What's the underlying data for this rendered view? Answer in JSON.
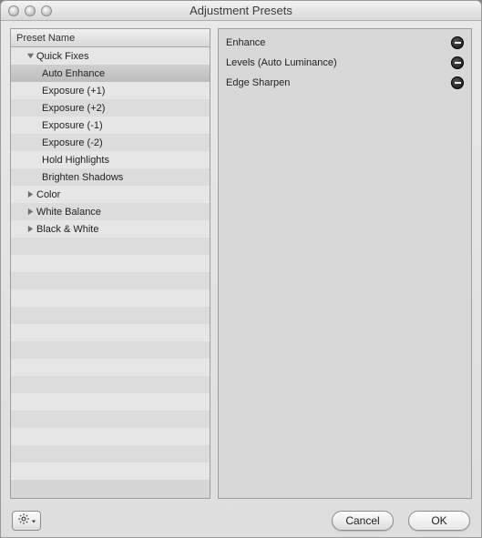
{
  "window": {
    "title": "Adjustment Presets"
  },
  "left": {
    "header": "Preset Name",
    "groups": [
      {
        "name": "Quick Fixes",
        "expanded": true,
        "children": [
          "Auto Enhance",
          "Exposure (+1)",
          "Exposure (+2)",
          "Exposure (-1)",
          "Exposure (-2)",
          "Hold Highlights",
          "Brighten Shadows"
        ],
        "selectedIndex": 0
      },
      {
        "name": "Color",
        "expanded": false,
        "children": []
      },
      {
        "name": "White Balance",
        "expanded": false,
        "children": []
      },
      {
        "name": "Black & White",
        "expanded": false,
        "children": []
      }
    ]
  },
  "right": {
    "adjustments": [
      "Enhance",
      "Levels (Auto Luminance)",
      "Edge Sharpen"
    ]
  },
  "footer": {
    "cancel": "Cancel",
    "ok": "OK"
  },
  "colors": {
    "panel_bg": "#d8d8d8",
    "row_alt0": "#e6e6e6",
    "row_alt1": "#dcdcdc",
    "selected": "#c6c6c6"
  }
}
